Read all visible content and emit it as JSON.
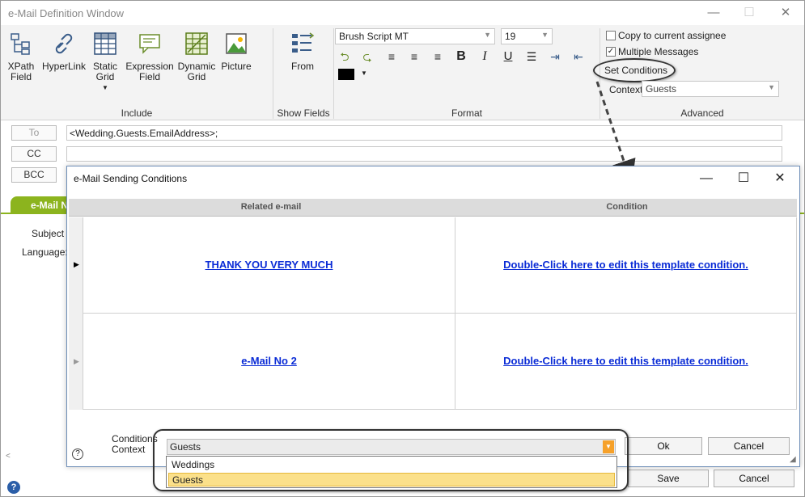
{
  "window": {
    "title": "e-Mail Definition Window"
  },
  "ribbon": {
    "include": [
      {
        "label": "XPath\nField"
      },
      {
        "label": "HyperLink"
      },
      {
        "label": "Static\nGrid"
      },
      {
        "label": "Expression\nField"
      },
      {
        "label": "Dynamic\nGrid"
      },
      {
        "label": "Picture"
      }
    ],
    "include_label": "Include",
    "from_label": "From",
    "show_fields_label": "Show Fields",
    "font": "Brush Script MT",
    "font_size": "19",
    "format_label": "Format",
    "copy_assignee": "Copy to current assignee",
    "multiple_messages": "Multiple Messages",
    "set_conditions": "Set Conditions",
    "context_label": "Context",
    "context_value": "Guests",
    "advanced_label": "Advanced"
  },
  "address": {
    "to_label": "To",
    "to_value": "<Wedding.Guests.EmailAddress>;",
    "cc_label": "CC",
    "cc_value": "",
    "bcc_label": "BCC",
    "bcc_value": ""
  },
  "tab": {
    "label": "e-Mail N"
  },
  "form": {
    "subject_label": "Subject",
    "language_label": "Language:"
  },
  "dialog": {
    "title": "e-Mail Sending Conditions",
    "col_related": "Related e-mail",
    "col_condition": "Condition",
    "rows": [
      {
        "email": "THANK YOU VERY MUCH",
        "condition": "Double-Click here to edit this template condition."
      },
      {
        "email": "e-Mail No  2",
        "condition": "Double-Click here to edit this template condition."
      }
    ],
    "conditions_context_label": "Conditions\nContext",
    "context_value": "Guests",
    "options": [
      "Weddings",
      "Guests"
    ],
    "ok_label": "Ok",
    "cancel_label": "Cancel"
  },
  "footer": {
    "help": "?",
    "save_label": "Save",
    "cancel_label": "Cancel"
  },
  "colors": {
    "accent": "#8cb41e",
    "link": "#0b2cd6",
    "selected": "#fbe08a"
  }
}
